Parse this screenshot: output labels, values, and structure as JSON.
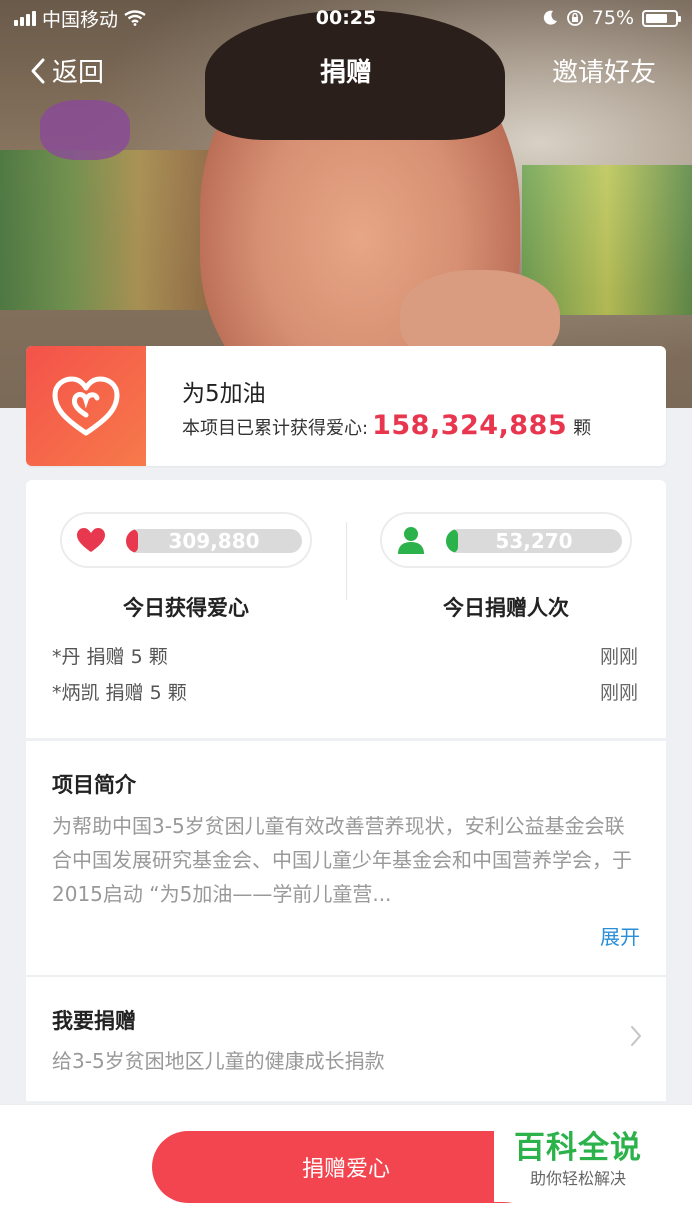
{
  "status_bar": {
    "carrier": "中国移动",
    "time": "00:25",
    "battery": "75%",
    "battery_level": 0.75
  },
  "nav": {
    "back_label": "返回",
    "title": "捐赠",
    "invite_label": "邀请好友"
  },
  "project": {
    "name": "为5加油",
    "total_prefix": "本项目已累计获得爱心:",
    "total_value": "158,324,885",
    "total_unit": "颗"
  },
  "stats": {
    "hearts": {
      "value": "309,880",
      "label": "今日获得爱心",
      "color": "#e8384f",
      "icon": "heart-icon"
    },
    "donors": {
      "value": "53,270",
      "label": "今日捐赠人次",
      "color": "#2bb24a",
      "icon": "person-icon"
    }
  },
  "recent_donations": [
    {
      "text": "*丹 捐赠 5 颗",
      "time": "刚刚"
    },
    {
      "text": "*炳凯 捐赠 5 颗",
      "time": "刚刚"
    }
  ],
  "intro": {
    "heading": "项目简介",
    "body": "为帮助中国3-5岁贫困儿童有效改善营养现状，安利公益基金会联合中国发展研究基金会、中国儿童少年基金会和中国营养学会，于2015启动 “为5加油——学前儿童营...",
    "expand_label": "展开"
  },
  "donate": {
    "heading": "我要捐赠",
    "subtitle": "给3-5岁贫困地区儿童的健康成长捐款"
  },
  "bottom": {
    "button_label": "捐赠爱心"
  },
  "watermark": {
    "title": "百科全说",
    "subtitle": "助你轻松解决"
  }
}
